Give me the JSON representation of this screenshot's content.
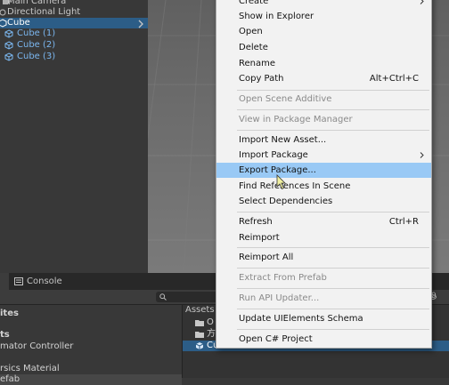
{
  "hierarchy": {
    "items": [
      {
        "label": "Main Camera"
      },
      {
        "label": "Directional Light"
      },
      {
        "label": "Cube"
      },
      {
        "label": "Cube (1)"
      },
      {
        "label": "Cube (2)"
      },
      {
        "label": "Cube (3)"
      }
    ]
  },
  "context_menu": {
    "items": [
      {
        "label": "Create"
      },
      {
        "label": "Show in Explorer"
      },
      {
        "label": "Open"
      },
      {
        "label": "Delete"
      },
      {
        "label": "Rename"
      },
      {
        "label": "Copy Path",
        "shortcut": "Alt+Ctrl+C"
      },
      {
        "label": "Open Scene Additive"
      },
      {
        "label": "View in Package Manager"
      },
      {
        "label": "Import New Asset..."
      },
      {
        "label": "Import Package"
      },
      {
        "label": "Export Package..."
      },
      {
        "label": "Find References In Scene"
      },
      {
        "label": "Select Dependencies"
      },
      {
        "label": "Refresh",
        "shortcut": "Ctrl+R"
      },
      {
        "label": "Reimport"
      },
      {
        "label": "Reimport All"
      },
      {
        "label": "Extract From Prefab"
      },
      {
        "label": "Run API Updater..."
      },
      {
        "label": "Update UIElements Schema"
      },
      {
        "label": "Open C# Project"
      }
    ]
  },
  "bottom": {
    "console_tab": "Console",
    "left_items": [
      {
        "label": "ites"
      },
      {
        "label": "ts"
      },
      {
        "label": "mator Controller"
      },
      {
        "label": "rsics Material"
      },
      {
        "label": "efab"
      }
    ],
    "assets_label": "Assets",
    "right_items": [
      {
        "label": "O"
      },
      {
        "label": "方"
      },
      {
        "label": "Cub"
      }
    ],
    "count": "9"
  },
  "colors": {
    "selection": "#2c5d87",
    "menu_highlight": "#99c9f5",
    "child_text": "#7bb7f0"
  }
}
